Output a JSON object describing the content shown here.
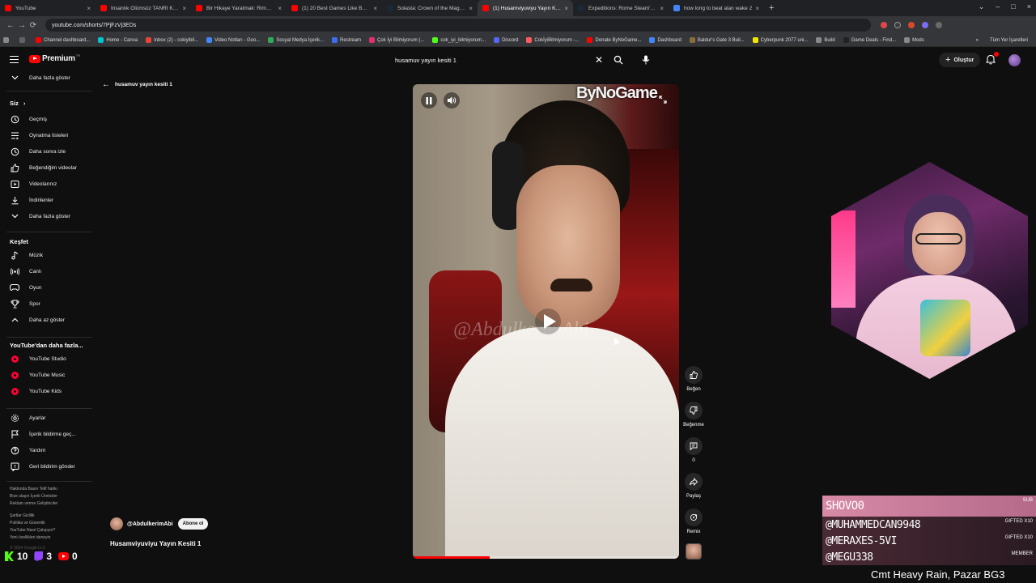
{
  "browser": {
    "tabs": [
      {
        "label": "YouTube",
        "color": "#ff0000",
        "active": false
      },
      {
        "label": "İnsanlık Ölümsüz TANRI Kralı Ar",
        "color": "#ff0000",
        "active": false
      },
      {
        "label": "Bir Hikaye Yaratmak: Rimworld",
        "color": "#ff0000",
        "active": false
      },
      {
        "label": "(1) 20 Best Games Like Baldur's",
        "color": "#ff0000",
        "active": false
      },
      {
        "label": "Solasta: Crown of the Magister",
        "color": "#1b2838",
        "active": false
      },
      {
        "label": "(1) Husamviyuviyu Yayın Kesiti",
        "color": "#ff0000",
        "active": true
      },
      {
        "label": "Expeditions: Rome Steam'de %",
        "color": "#1b2838",
        "active": false
      },
      {
        "label": "how long to beat alan wake 2",
        "color": "#4285f4",
        "active": false
      }
    ],
    "tab_close": "×",
    "new_tab": "+",
    "window_controls": [
      "⌄",
      "–",
      "□",
      "×"
    ],
    "url": "youtube.com/shorts/7PjFzVj3EDs",
    "bookmarks": [
      {
        "label": "Channel dashboard...",
        "color": "#ff0000"
      },
      {
        "label": "Home - Canva",
        "color": "#00c4cc"
      },
      {
        "label": "Inbox (2) - cokiyibil...",
        "color": "#ea4335"
      },
      {
        "label": "Video Notları - Goo...",
        "color": "#4285f4"
      },
      {
        "label": "Sosyal Medya İçerik...",
        "color": "#34a853"
      },
      {
        "label": "Restream",
        "color": "#3a6df0"
      },
      {
        "label": "Çok İyi Bilmiyorum (...",
        "color": "#e1306c"
      },
      {
        "label": "cok_iyi_bilmiyorum...",
        "color": "#53fc18"
      },
      {
        "label": "Discord",
        "color": "#5865f2"
      },
      {
        "label": "CokİyiBilmiyorum -...",
        "color": "#ff5a5f"
      },
      {
        "label": "Donate ByNoGame...",
        "color": "#ff0000"
      },
      {
        "label": "Dashboard",
        "color": "#4285f4"
      },
      {
        "label": "Baldur's Gate 3 Buil...",
        "color": "#8a6d3b"
      },
      {
        "label": "Cyberpunk 2077 uni...",
        "color": "#f3e600"
      },
      {
        "label": "Build",
        "color": "#888888"
      },
      {
        "label": "Game Deals - Find...",
        "color": "#222222"
      },
      {
        "label": "Mods",
        "color": "#888888"
      }
    ],
    "bookmarks_more": "»",
    "all_bookmarks": "Tüm Yer İşaretleri"
  },
  "header": {
    "logo_text": "Premium",
    "logo_tr": "TR",
    "search_value": "husamuv yayın kesiti 1",
    "create_label": "Oluştur",
    "create_plus": "+"
  },
  "sidebar": {
    "more_top": "Daha fazla göster",
    "you_heading": "Siz",
    "you_items": [
      {
        "label": "Geçmiş",
        "icon": "history-icon"
      },
      {
        "label": "Oynatma listeleri",
        "icon": "playlist-icon"
      },
      {
        "label": "Daha sonra izle",
        "icon": "clock-icon"
      },
      {
        "label": "Beğendiğim videolar",
        "icon": "like-icon"
      },
      {
        "label": "Videolarınız",
        "icon": "video-icon"
      },
      {
        "label": "İndirilenler",
        "icon": "download-icon"
      },
      {
        "label": "Daha fazla göster",
        "icon": "chevron-down-icon"
      }
    ],
    "explore_heading": "Keşfet",
    "explore_items": [
      {
        "label": "Müzik",
        "icon": "music-icon"
      },
      {
        "label": "Canlı",
        "icon": "live-icon"
      },
      {
        "label": "Oyun",
        "icon": "gaming-icon"
      },
      {
        "label": "Spor",
        "icon": "trophy-icon"
      },
      {
        "label": "Daha az göster",
        "icon": "chevron-up-icon"
      }
    ],
    "more_yt_heading": "YouTube'dan daha fazla...",
    "more_yt_items": [
      {
        "label": "YouTube Studio"
      },
      {
        "label": "YouTube Music"
      },
      {
        "label": "YouTube Kids"
      }
    ],
    "settings_items": [
      {
        "label": "Ayarlar",
        "icon": "gear-icon"
      },
      {
        "label": "İçerik bildirme geç...",
        "icon": "flag-icon"
      },
      {
        "label": "Yardım",
        "icon": "help-icon"
      },
      {
        "label": "Geri bildirim gönder",
        "icon": "feedback-icon"
      }
    ],
    "footer_1": "Hakkında  Basın  Telif hakkı",
    "footer_2": "Bize ulaşın  İçerik Üreticiler",
    "footer_3": "Reklam verme  Geliştiriciler",
    "footer_4": "Şartlar  Gizlilik",
    "footer_5": "Politika ve Güvenlik",
    "footer_6": "YouTube Nasıl Çalışıyor?",
    "footer_7": "Yeni özellikleri deneyin",
    "footer_8": "© 2024 Google LLC"
  },
  "main": {
    "back_label": "husamuv yayın kesiti 1",
    "video": {
      "brand_overlay": "ByNoGame",
      "watermark": "@AbdulkerimAbi",
      "progress": 0.29
    },
    "channel_name": "@AbdulkerimAbi",
    "subscribe_label": "Abone ol",
    "title": "Husamviyuviyu Yayın Kesiti 1",
    "actions": {
      "like": "Beğen",
      "dislike": "Beğenme",
      "comments": "0",
      "share": "Paylaş",
      "remix": "Remix"
    }
  },
  "overlay": {
    "alerts": [
      {
        "name": "SHOVO0",
        "tag": "SUB"
      },
      {
        "name": "@MUHAMMEDCAN9948",
        "tag": "GIFTED X10"
      },
      {
        "name": "@MERAXES-5VI",
        "tag": "GIFTED X10"
      },
      {
        "name": "@MEGU338",
        "tag": "MEMBER"
      }
    ],
    "ticker": "Cmt Heavy Rain, Pazar BG3",
    "stats": {
      "kick": "10",
      "twitch": "3",
      "youtube": "0"
    }
  }
}
